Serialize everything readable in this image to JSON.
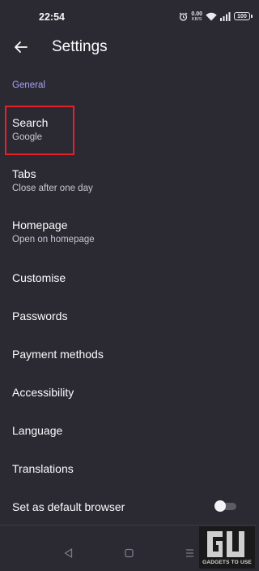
{
  "status_bar": {
    "time": "22:54",
    "net_speed": "0.00",
    "net_unit": "KB/S",
    "battery": "100",
    "icons": [
      "alarm-icon",
      "wifi-icon",
      "signal-icon",
      "battery-icon"
    ]
  },
  "header": {
    "title": "Settings",
    "back_icon": "arrow-left-icon"
  },
  "section": {
    "label": "General"
  },
  "items": [
    {
      "label": "Search",
      "sub": "Google"
    },
    {
      "label": "Tabs",
      "sub": "Close after one day"
    },
    {
      "label": "Homepage",
      "sub": "Open on homepage"
    },
    {
      "label": "Customise"
    },
    {
      "label": "Passwords"
    },
    {
      "label": "Payment methods"
    },
    {
      "label": "Accessibility"
    },
    {
      "label": "Language"
    },
    {
      "label": "Translations"
    },
    {
      "label": "Set as default browser",
      "toggle": false
    }
  ],
  "watermark": {
    "text": "GADGETS TO USE"
  },
  "colors": {
    "background": "#2b2a33",
    "accent": "#a7a0f5",
    "highlight": "#e8202a"
  }
}
